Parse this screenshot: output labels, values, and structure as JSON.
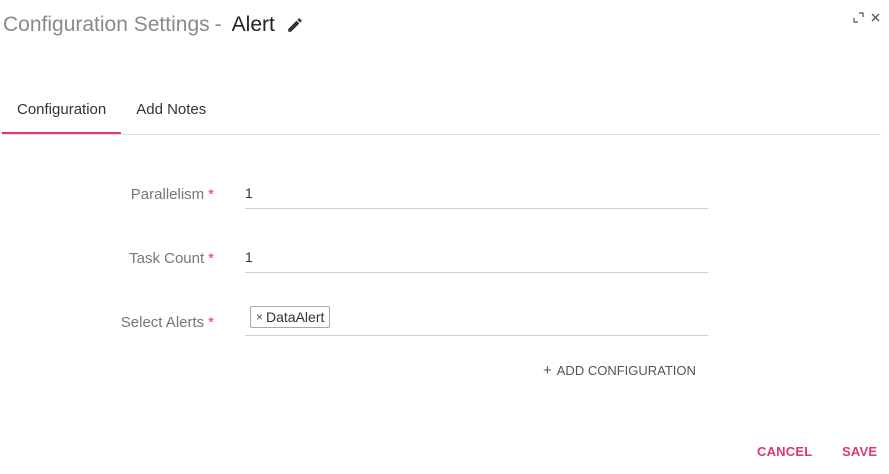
{
  "header": {
    "title_prefix": "Configuration Settings",
    "title_separator": "-",
    "title_name": "Alert",
    "edit_icon": "pencil-icon",
    "expand_icon": "expand-icon",
    "close_icon": "close-icon"
  },
  "tabs": [
    {
      "label": "Configuration",
      "active": true
    },
    {
      "label": "Add Notes",
      "active": false
    }
  ],
  "form": {
    "parallelism": {
      "label": "Parallelism",
      "required_mark": "*",
      "value": "1"
    },
    "task_count": {
      "label": "Task Count",
      "required_mark": "*",
      "value": "1"
    },
    "select_alerts": {
      "label": "Select Alerts",
      "required_mark": "*",
      "chips": [
        {
          "remove": "×",
          "label": "DataAlert"
        }
      ]
    }
  },
  "add_configuration": {
    "icon": "+",
    "label": "ADD CONFIGURATION"
  },
  "footer": {
    "cancel_label": "CANCEL",
    "save_label": "SAVE"
  },
  "colors": {
    "accent": "#e0376c",
    "muted_text": "#777777"
  }
}
